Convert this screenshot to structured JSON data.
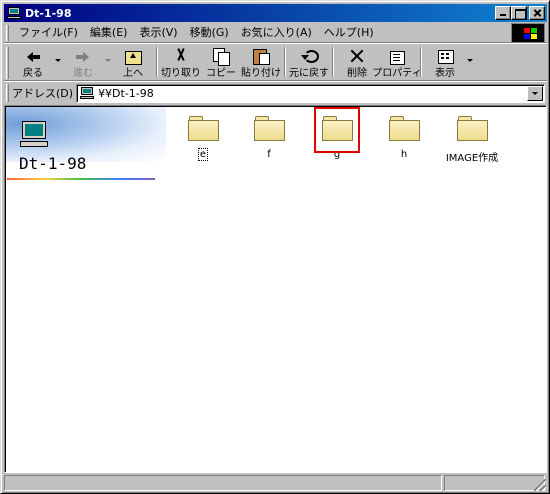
{
  "window": {
    "title": "Dt-1-98"
  },
  "menu": {
    "items": [
      {
        "label": "ファイル(F)"
      },
      {
        "label": "編集(E)"
      },
      {
        "label": "表示(V)"
      },
      {
        "label": "移動(G)"
      },
      {
        "label": "お気に入り(A)"
      },
      {
        "label": "ヘルプ(H)"
      }
    ]
  },
  "toolbar": {
    "back": "戻る",
    "forward": "進む",
    "up": "上へ",
    "cut": "切り取り",
    "copy": "コピー",
    "paste": "貼り付け",
    "undo": "元に戻す",
    "delete": "削除",
    "properties": "プロパティ",
    "view": "表示"
  },
  "address": {
    "label": "アドレス(D)",
    "value": "¥¥Dt-1-98"
  },
  "panel": {
    "title": "Dt-1-98"
  },
  "folders": [
    {
      "label": "e"
    },
    {
      "label": "f"
    },
    {
      "label": "g"
    },
    {
      "label": "h"
    },
    {
      "label": "IMAGE作成"
    }
  ],
  "colors": {
    "titlebar_start": "#000080",
    "titlebar_end": "#1084d0",
    "annotation": "#e00000"
  }
}
